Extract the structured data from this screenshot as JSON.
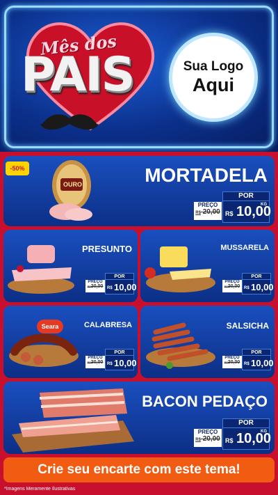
{
  "header": {
    "title_small": "Mês dos",
    "title_big": "PAIS",
    "logo_line1": "Sua Logo",
    "logo_line2": "Aqui"
  },
  "featured": [
    {
      "name": "MORTADELA",
      "badge": "-50%",
      "brand_label": "OURO",
      "por": "POR",
      "preco": "PREÇO",
      "old_price": "20,00",
      "old_prefix": "R$",
      "new_prefix": "R$",
      "new_price": "10,00",
      "unit": "KG"
    },
    {
      "name": "BACON PEDAÇO",
      "por": "POR",
      "preco": "PREÇO",
      "old_price": "20,00",
      "old_prefix": "R$",
      "new_prefix": "R$",
      "new_price": "10,00",
      "unit": "KG"
    }
  ],
  "grid": [
    {
      "name": "PRESUNTO",
      "por": "POR",
      "preco": "PREÇO",
      "old_prefix": "R$",
      "old_price": "20,00",
      "new_prefix": "R$",
      "new_price": "10,00"
    },
    {
      "name": "MUSSARELA",
      "por": "POR",
      "preco": "PREÇO",
      "old_prefix": "R$",
      "old_price": "20,00",
      "new_prefix": "R$",
      "new_price": "10,00"
    },
    {
      "name": "CALABRESA",
      "brand_label": "Seara",
      "por": "POR",
      "preco": "PREÇO",
      "old_prefix": "R$",
      "old_price": "20,00",
      "new_prefix": "R$",
      "new_price": "10,00"
    },
    {
      "name": "SALSICHA",
      "por": "POR",
      "preco": "PREÇO",
      "old_prefix": "R$",
      "old_price": "20,00",
      "new_prefix": "R$",
      "new_price": "10,00"
    }
  ],
  "cta": "Crie seu encarte com este tema!",
  "footnote": "*Imagens Meramente Ilustrativas",
  "colors": {
    "background": "#c8102e",
    "panel": "#1a4fbf",
    "cta": "#f25c12",
    "badge": "#ffd400"
  },
  "icons": [
    "heart-icon",
    "mustache-icon"
  ]
}
